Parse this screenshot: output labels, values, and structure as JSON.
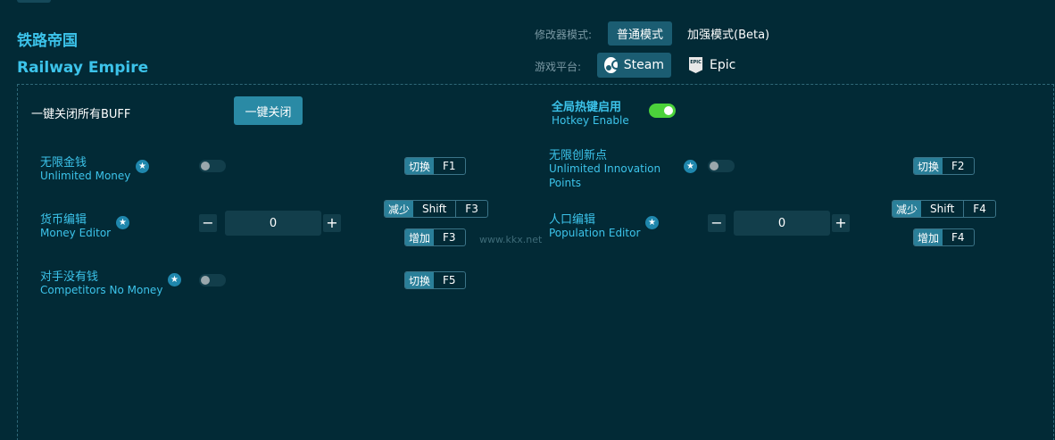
{
  "header": {
    "title_cn": "铁路帝国",
    "title_en": "Railway Empire",
    "mode_label": "修改器模式:",
    "mode_normal": "普通模式",
    "mode_enhanced": "加强模式(Beta)",
    "platform_label": "游戏平台:",
    "platform_steam": "Steam",
    "platform_epic": "Epic"
  },
  "controls": {
    "close_all_label": "一键关闭所有BUFF",
    "close_all_button": "一键关闭",
    "hotkey_cn": "全局热键启用",
    "hotkey_en": "Hotkey Enable"
  },
  "features": [
    {
      "cn": "无限金钱",
      "en": "Unlimited Money",
      "tag": "切换",
      "key": "F1"
    },
    {
      "cn": "无限创新点",
      "en": "Unlimited Innovation Points",
      "tag": "切换",
      "key": "F2"
    },
    {
      "cn": "货币编辑",
      "en": "Money Editor",
      "value": "0",
      "dec_tag": "减少",
      "mod": "Shift",
      "dec_key": "F3",
      "inc_tag": "增加",
      "inc_key": "F3"
    },
    {
      "cn": "人口编辑",
      "en": "Population Editor",
      "value": "0",
      "dec_tag": "减少",
      "mod": "Shift",
      "dec_key": "F4",
      "inc_tag": "增加",
      "inc_key": "F4"
    },
    {
      "cn": "对手没有钱",
      "en": "Competitors No Money",
      "tag": "切换",
      "key": "F5"
    }
  ],
  "glyphs": {
    "star": "★",
    "minus": "−",
    "plus": "+",
    "epic": "EPIC"
  },
  "watermark": "www.kkx.net",
  "colors": {
    "background": "#022a36",
    "accent": "#3cc3ea",
    "active_button": "#1b5d72",
    "toggle_on": "#4bd23b"
  }
}
